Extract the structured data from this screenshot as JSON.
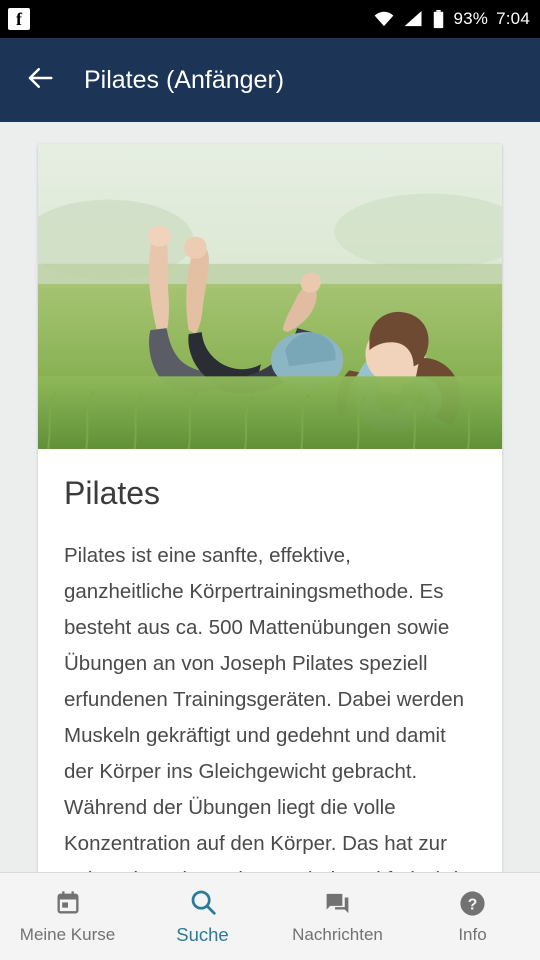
{
  "status_bar": {
    "notification_icon": "facebook-icon",
    "wifi_icon": "wifi-icon",
    "signal_icon": "cellular-signal-icon",
    "battery_icon": "battery-icon",
    "battery_level": "93%",
    "time": "7:04"
  },
  "app_bar": {
    "back_icon": "arrow-back-icon",
    "title": "Pilates (Anfänger)"
  },
  "card": {
    "image_alt": "two-women-doing-pilates-in-a-meadow",
    "title": "Pilates",
    "body": "Pilates ist eine sanfte, effektive, ganzheitliche Körpertrainingsmethode. Es besteht aus ca. 500 Mattenübungen sowie Übungen an von Joseph Pilates speziell erfundenen Trainingsgeräten. Dabei werden Muskeln gekräftigt und gedehnt und damit der Körper ins Gleichgewicht gebracht. Während der Übungen liegt die volle Konzentration auf den Körper. Das hat zur Folge, dass der Geist geschult und frei wird."
  },
  "bottom_nav": {
    "items": [
      {
        "label": "Meine Kurse",
        "icon": "calendar-icon",
        "active": false
      },
      {
        "label": "Suche",
        "icon": "search-icon",
        "active": true
      },
      {
        "label": "Nachrichten",
        "icon": "chat-icon",
        "active": false
      },
      {
        "label": "Info",
        "icon": "help-icon",
        "active": false
      }
    ]
  },
  "colors": {
    "app_bar": "#1c3557",
    "accent": "#2b7b9b",
    "background": "#eceded",
    "card": "#ffffff"
  }
}
